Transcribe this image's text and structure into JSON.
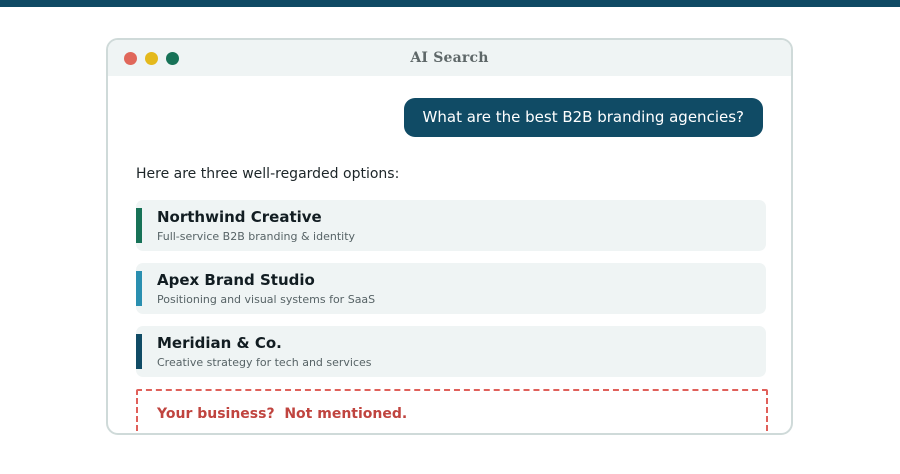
{
  "window": {
    "title": "AI Search"
  },
  "chat": {
    "query": "What are the best B2B branding agencies?",
    "intro": "Here are three well-regarded options:",
    "results": [
      {
        "name": "Northwind Creative",
        "description": "Full-service B2B branding & identity",
        "accent": "#177257"
      },
      {
        "name": "Apex Brand Studio",
        "description": "Positioning and visual systems for SaaS",
        "accent": "#2a8fb0"
      },
      {
        "name": "Meridian & Co.",
        "description": "Creative strategy for tech and services",
        "accent": "#104b65"
      }
    ],
    "missing_callout": "Your business?  Not mentioned."
  },
  "colors": {
    "brand": "#0f4a64",
    "query_bubble": "#104b65",
    "card_bg": "#eff4f4",
    "alert": "#e0605a",
    "alert_text": "#c0443f"
  }
}
